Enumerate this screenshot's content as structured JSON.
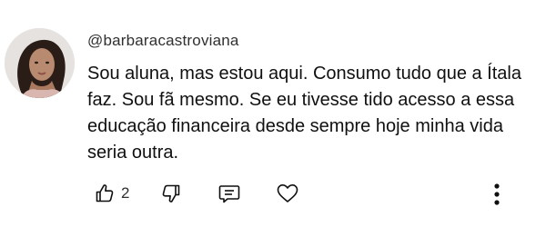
{
  "comment": {
    "username": "@barbaracastroviana",
    "text": "Sou aluna, mas estou aqui. Consumo tudo que a Ítala faz. Sou fã mesmo. Se eu tivesse tido acesso a essa educação financeira desde sempre hoje minha vida seria outra.",
    "like_count": "2"
  },
  "icons": {
    "avatar": "avatar",
    "like": "thumbs-up-icon",
    "dislike": "thumbs-down-icon",
    "reply": "reply-comment-icon",
    "heart": "heart-icon",
    "more": "more-vertical-icon"
  },
  "colors": {
    "text": "#101010",
    "secondary_text": "#303030",
    "icon": "#0f0f0f",
    "background": "#ffffff"
  }
}
